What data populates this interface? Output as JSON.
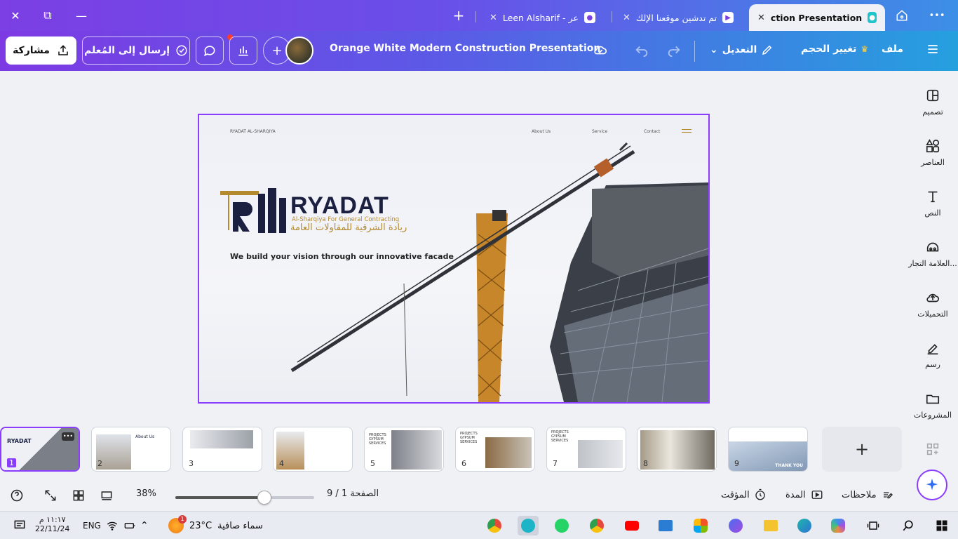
{
  "window": {
    "close": "✕",
    "restore": "⧉",
    "minimize": "—"
  },
  "tabs": [
    {
      "label": "ction Presentation",
      "close": "✕",
      "active": true
    },
    {
      "label": "تم تدشين موقعنا الإلك",
      "close": "✕"
    },
    {
      "label": "Leen Alsharif - عر",
      "close": "✕"
    }
  ],
  "tab_extra": {
    "new_tab": "+",
    "more": "•••"
  },
  "toolbar": {
    "share": "مشاركة",
    "send_to_teacher": "إرسال إلى المُعلم",
    "add": "+",
    "doc_title": "Orange White Modern Construction Presentation",
    "edit": "التعديل",
    "resize": "تغيير الحجم",
    "file": "ملف"
  },
  "sidebar": {
    "items": [
      {
        "label": "تصميم",
        "icon": "design-icon"
      },
      {
        "label": "العناصر",
        "icon": "elements-icon"
      },
      {
        "label": "النص",
        "icon": "text-icon"
      },
      {
        "label": "العلامة التجار...",
        "icon": "brand-icon"
      },
      {
        "label": "التحميلات",
        "icon": "upload-icon"
      },
      {
        "label": "رسم",
        "icon": "draw-icon"
      },
      {
        "label": "المشروعات",
        "icon": "folder-icon"
      }
    ]
  },
  "slide": {
    "top_left": "RYADAT AL-SHARQIYA",
    "nav": [
      "About Us",
      "Service",
      "Contact"
    ],
    "brand": "RYADAT",
    "brand_sub": "Al-Sharqiya For General Contracting",
    "brand_ar": "ريادة الشرقية للمقاولات العامة",
    "tagline": "We build your vision through our innovative facade"
  },
  "thumbnails": [
    {
      "num": "1",
      "label": "RYADAT"
    },
    {
      "num": "2",
      "label": "About Us"
    },
    {
      "num": "3",
      "label": ""
    },
    {
      "num": "4",
      "label": ""
    },
    {
      "num": "5",
      "label": "PROJECTS GYPSUM SERVICES"
    },
    {
      "num": "6",
      "label": "PROJECTS GYPSUM SERVICES"
    },
    {
      "num": "7",
      "label": "PROJECTS GYPSUM SERVICES"
    },
    {
      "num": "8",
      "label": ""
    },
    {
      "num": "9",
      "label": "THANK YOU"
    }
  ],
  "add_page": "+",
  "bottom": {
    "zoom": "38%",
    "zoom_fraction": 0.38,
    "page": "الصفحة 1 / 9",
    "timer": "المؤقت",
    "duration": "المدة",
    "notes": "ملاحظات"
  },
  "taskbar": {
    "time": "١١:١٧ م",
    "date": "22/11/24",
    "lang": "ENG",
    "weather_temp": "23°C",
    "weather_text": "سماء صافية",
    "weather_badge": "1"
  },
  "colors": {
    "accent": "#8b3dff",
    "brand_navy": "#1b2040",
    "brand_gold": "#b38a2d"
  }
}
